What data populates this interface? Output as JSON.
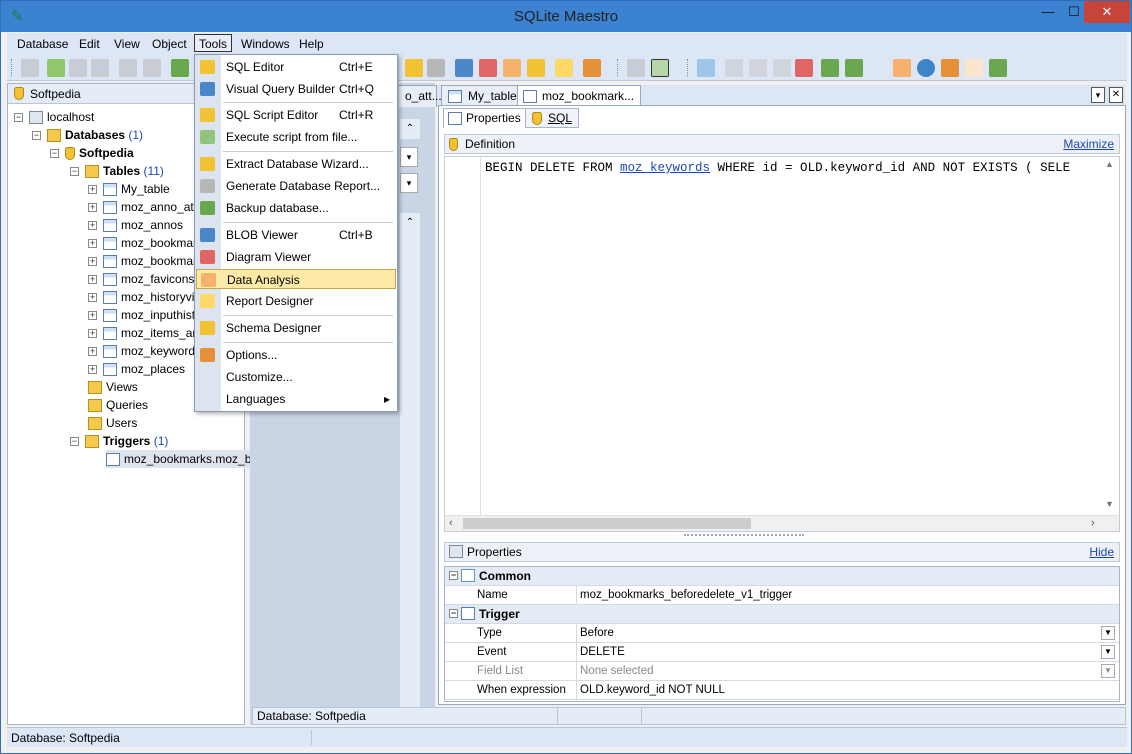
{
  "app": {
    "title": "SQLite Maestro"
  },
  "window_controls": {
    "minimize": "—",
    "maximize": "☐",
    "close": "✕"
  },
  "menubar": [
    "Database",
    "Edit",
    "View",
    "Object",
    "Tools",
    "Windows",
    "Help"
  ],
  "tools_menu": {
    "items": [
      {
        "label": "SQL Editor",
        "shortcut": "Ctrl+E"
      },
      {
        "label": "Visual Query Builder",
        "shortcut": "Ctrl+Q"
      },
      {
        "label": "SQL Script Editor",
        "shortcut": "Ctrl+R"
      },
      {
        "label": "Execute script from file...",
        "shortcut": ""
      },
      {
        "label": "Extract Database Wizard...",
        "shortcut": ""
      },
      {
        "label": "Generate Database Report...",
        "shortcut": ""
      },
      {
        "label": "Backup database...",
        "shortcut": ""
      },
      {
        "label": "BLOB Viewer",
        "shortcut": "Ctrl+B"
      },
      {
        "label": "Diagram Viewer",
        "shortcut": ""
      },
      {
        "label": "Data Analysis",
        "shortcut": ""
      },
      {
        "label": "Report Designer",
        "shortcut": ""
      },
      {
        "label": "Schema Designer",
        "shortcut": ""
      },
      {
        "label": "Options...",
        "shortcut": ""
      },
      {
        "label": "Customize...",
        "shortcut": ""
      },
      {
        "label": "Languages",
        "shortcut": "▸"
      }
    ],
    "highlighted": "Data Analysis"
  },
  "explorer": {
    "header": "Softpedia",
    "tree": {
      "host": "localhost",
      "databases_label": "Databases",
      "databases_count": "(1)",
      "database": "Softpedia",
      "tables_label": "Tables",
      "tables_count": "(11)",
      "tables": [
        "My_table",
        "moz_anno_att",
        "moz_annos",
        "moz_bookmark",
        "moz_bookmark",
        "moz_favicons",
        "moz_historyvis",
        "moz_inputhisto",
        "moz_items_an",
        "moz_keywords",
        "moz_places"
      ],
      "views": "Views",
      "queries": "Queries",
      "users": "Users",
      "triggers_label": "Triggers",
      "triggers_count": "(1)",
      "trigger_item": "moz_bookmarks.moz_bo"
    }
  },
  "doc_tabs": [
    "o_att...",
    "My_table",
    "moz_bookmark..."
  ],
  "subtabs": {
    "properties": "Properties",
    "sql": "SQL"
  },
  "definition": {
    "label": "Definition",
    "maximize": "Maximize",
    "code_prefix": "BEGIN DELETE FROM ",
    "code_link": "moz_keywords",
    "code_suffix": " WHERE id = OLD.keyword_id AND NOT EXISTS ( SELE"
  },
  "properties": {
    "label": "Properties",
    "hide": "Hide",
    "sections": {
      "common": "Common",
      "trigger": "Trigger"
    },
    "rows": {
      "name": {
        "label": "Name",
        "value": "moz_bookmarks_beforedelete_v1_trigger"
      },
      "type": {
        "label": "Type",
        "value": "Before"
      },
      "event": {
        "label": "Event",
        "value": "DELETE"
      },
      "field_list": {
        "label": "Field List",
        "value": "None selected"
      },
      "when": {
        "label": "When expression",
        "value": "OLD.keyword_id NOT NULL"
      }
    }
  },
  "status": {
    "doc": "Database: Softpedia",
    "main": "Database: Softpedia"
  }
}
